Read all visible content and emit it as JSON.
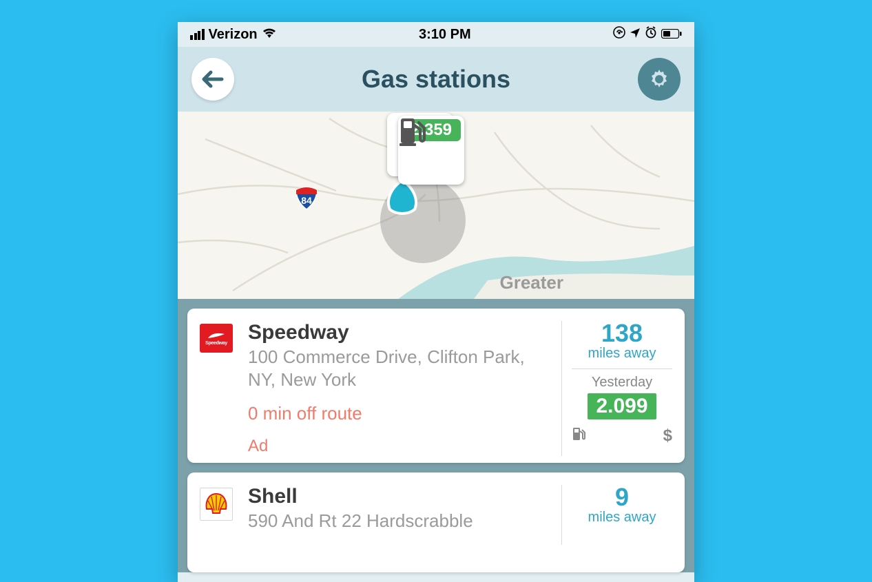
{
  "status_bar": {
    "carrier": "Verizon",
    "time": "3:10 PM"
  },
  "header": {
    "title": "Gas stations"
  },
  "map": {
    "region_label": "Greater",
    "route_shield": "84",
    "marker_price": "2.359"
  },
  "stations": [
    {
      "brand": "Speedway",
      "name": "Speedway",
      "address": "100 Commerce Drive, Clifton Park, NY, New York",
      "off_route": "0 min off route",
      "ad_label": "Ad",
      "distance": "138",
      "distance_unit": "miles away",
      "updated": "Yesterday",
      "price": "2.099"
    },
    {
      "brand": "Shell",
      "name": "Shell",
      "address": "590 And Rt 22 Hardscrabble",
      "distance": "9",
      "distance_unit": "miles away"
    }
  ]
}
